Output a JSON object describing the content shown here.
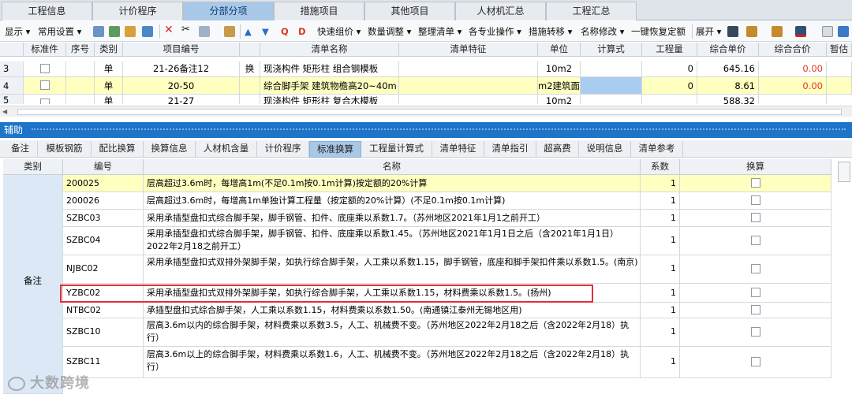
{
  "main_tabs": [
    "工程信息",
    "计价程序",
    "分部分项",
    "措施项目",
    "其他项目",
    "人材机汇总",
    "工程汇总"
  ],
  "toolbar": {
    "items": [
      "显示",
      "常用设置",
      "快速组价",
      "数量调整",
      "整理清单",
      "各专业操作",
      "措施转移",
      "名称修改",
      "一键恢复定额",
      "展开"
    ]
  },
  "grid": {
    "headers": [
      "标准件",
      "序号",
      "类别",
      "项目编号",
      "清单名称",
      "清单特征",
      "单位",
      "计算式",
      "工程量",
      "综合单价",
      "综合合价",
      "暂估"
    ],
    "rows": [
      {
        "index": "3",
        "cat": "单",
        "code": "21-26备注12",
        "mark": "换",
        "name": "现浇构件 矩形柱 组合钢模板",
        "unit": "10m2",
        "qty": "0",
        "price": "645.16",
        "total": "0.00"
      },
      {
        "index": "4",
        "cat": "单",
        "code": "20-50",
        "mark": "",
        "name": "综合脚手架 建筑物檐高20~40m",
        "unit": "m2建筑面",
        "qty": "0",
        "price": "8.61",
        "total": "0.00"
      },
      {
        "index": "5",
        "cat": "单",
        "code": "21-27",
        "mark": "",
        "name": "现浇构件 矩形柱 复合木模板",
        "unit": "10m2",
        "qty": "",
        "price": "588.32",
        "total": ""
      }
    ]
  },
  "aux": {
    "title": "辅助",
    "tabs": [
      "备注",
      "模板钢筋",
      "配比换算",
      "换算信息",
      "人材机含量",
      "计价程序",
      "标准换算",
      "工程量计算式",
      "清单特征",
      "清单指引",
      "超高费",
      "说明信息",
      "清单参考"
    ],
    "headers": [
      "类别",
      "编号",
      "名称",
      "系数",
      "换算"
    ],
    "category": "备注",
    "rows": [
      {
        "code": "200025",
        "name": "层高超过3.6m时，每增高1m(不足0.1m按0.1m计算)按定额的20%计算",
        "coef": "1"
      },
      {
        "code": "200026",
        "name": "层高超过3.6m时，每增高1m单独计算工程量（按定额的20%计算）(不足0.1m按0.1m计算)",
        "coef": "1"
      },
      {
        "code": "SZBC03",
        "name": "采用承插型盘扣式综合脚手架，脚手钢管、扣件、底座乘以系数1.7。（苏州地区2021年1月1之前开工）",
        "coef": "1"
      },
      {
        "code": "SZBC04",
        "name": "采用承插型盘扣式综合脚手架，脚手钢管、扣件、底座乘以系数1.45。（苏州地区2021年1月1日之后（含2021年1月1日）2022年2月18之前开工）",
        "coef": "1"
      },
      {
        "code": "NJBC02",
        "name": "采用承插型盘扣式双排外架脚手架，如执行综合脚手架，人工乘以系数1.15，脚手钢管，底座和脚手架扣件乘以系数1.5。(南京)",
        "coef": "1"
      },
      {
        "code": "YZBC02",
        "name": "采用承插型盘扣式双排外架脚手架，如执行综合脚手架，人工乘以系数1.15，材料费乘以系数1.5。(扬州)",
        "coef": "1"
      },
      {
        "code": "NTBC02",
        "name": "承插型盘扣式综合脚手架，人工乘以系数1.15，材料费乘以系数1.50。(南通镇江泰州无锡地区用)",
        "coef": "1"
      },
      {
        "code": "SZBC10",
        "name": "层高3.6m以内的综合脚手架，材料费乘以系数3.5，人工、机械费不变。（苏州地区2022年2月18之后（含2022年2月18）执行）",
        "coef": "1"
      },
      {
        "code": "SZBC11",
        "name": "层高3.6m以上的综合脚手架，材料费乘以系数1.6，人工、机械费不变。（苏州地区2022年2月18之后（含2022年2月18）执行）",
        "coef": "1"
      }
    ]
  },
  "watermark": "大数跨境",
  "colors": {
    "active_tab": "#a9c7e6",
    "selected_row": "#ffffc0",
    "highlight_box": "#e0303a",
    "splitter": "#1d74c9"
  }
}
